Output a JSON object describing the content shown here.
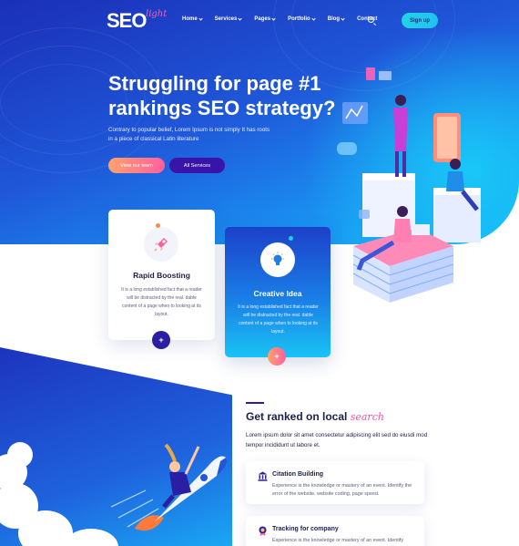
{
  "brand": {
    "logo_text": "SEO",
    "logo_suffix": "light"
  },
  "nav": {
    "items": [
      {
        "label": "Home",
        "dropdown": true
      },
      {
        "label": "Services",
        "dropdown": true
      },
      {
        "label": "Pages",
        "dropdown": true
      },
      {
        "label": "Portfolio",
        "dropdown": true
      },
      {
        "label": "Blog",
        "dropdown": true
      },
      {
        "label": "Contact",
        "dropdown": false
      }
    ],
    "search_icon": "search-icon",
    "signup_label": "Sign up"
  },
  "hero": {
    "title": "Struggling for page #1 rankings SEO strategy?",
    "description": "Contrary to popular belief, Lorem Ipsum is not simply It has roots in a piece of classical Latin literature",
    "primary_button": "View our team",
    "secondary_button": "All Services"
  },
  "features": [
    {
      "icon": "rocket-icon",
      "title": "Rapid Boosting",
      "text": "It is a long established fact that a reader will be distracted by the real. dable content of a page when to looking at its layout.",
      "action": "+"
    },
    {
      "icon": "lightbulb-icon",
      "title": "Creative Idea",
      "text": "It is a long established fact that a reader will be distracted by the real. dable content of a page when to looking at its layout.",
      "action": "+"
    }
  ],
  "ranked": {
    "title": "Get ranked on local",
    "title_emphasis": "search",
    "description": "Lorem ipsum dolor sit amet consectetur adipiscing elit sed do eiusdi mod tempor incididunt ut labore et.",
    "items": [
      {
        "icon": "bank-icon",
        "title": "Citation Building",
        "text": "Experience is the knowledge or mastery of an event. Identify the error of the website. website coding, page speed."
      },
      {
        "icon": "badge-icon",
        "title": "Tracking for company",
        "text": "Experience is the knowledge or mastery of an event. Identify"
      }
    ]
  },
  "colors": {
    "primary": "#1f57d8",
    "accent_pink": "#ff5f9e",
    "accent_orange": "#ffa26b",
    "deep_purple": "#2a1ea3",
    "cyan": "#20d4e6"
  }
}
